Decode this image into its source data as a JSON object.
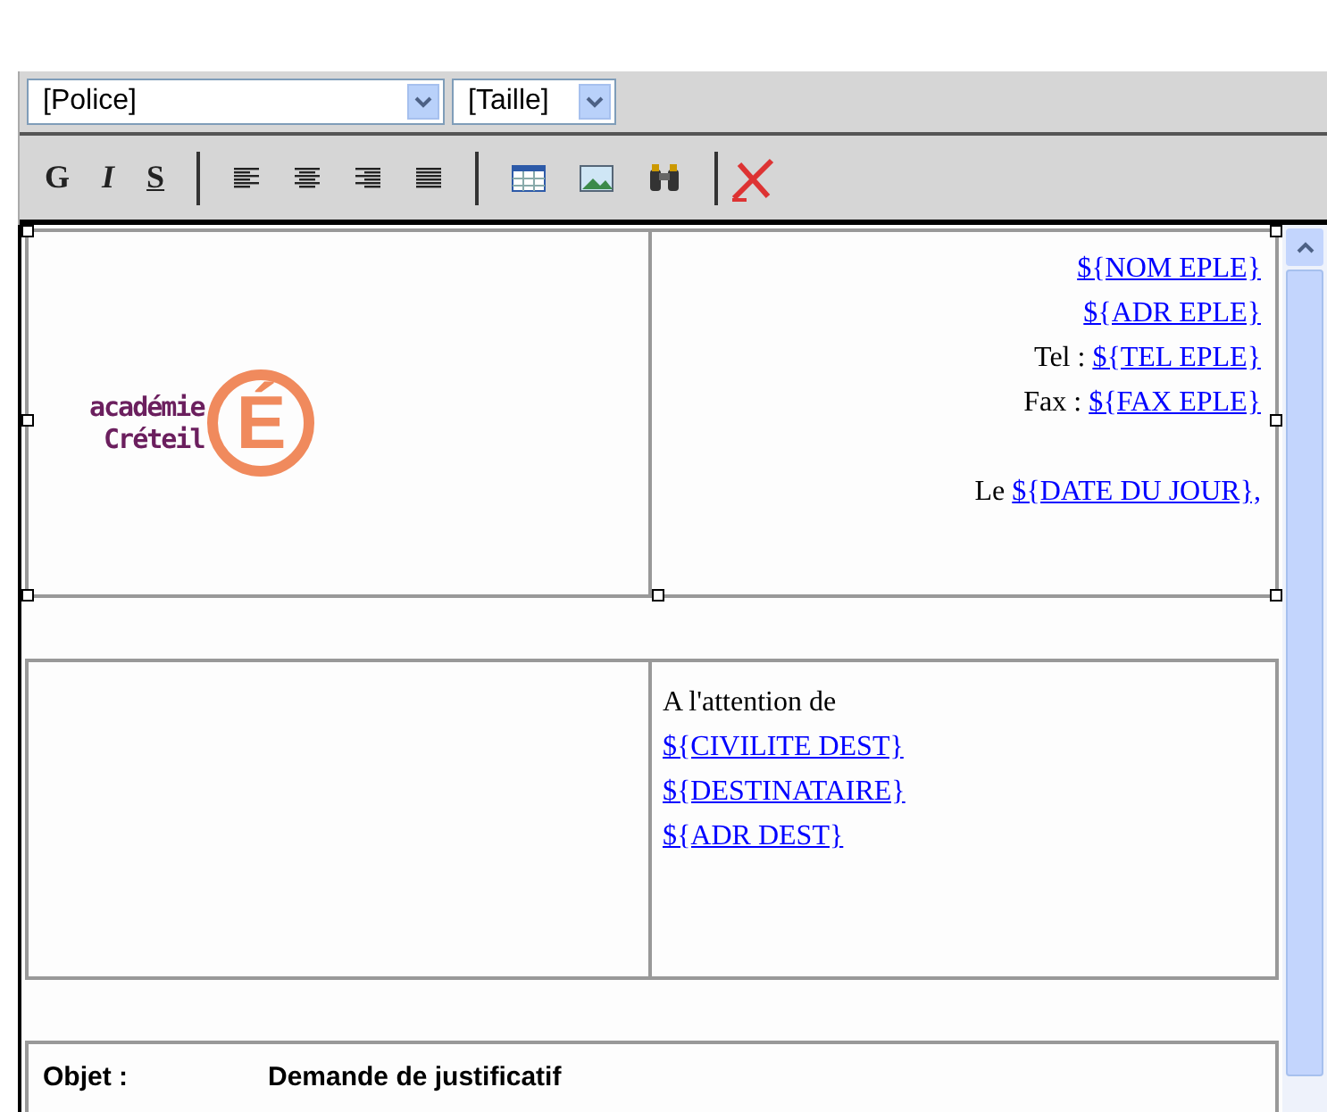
{
  "toolbar": {
    "font_select": {
      "value": "[Police]"
    },
    "size_select": {
      "value": "[Taille]"
    },
    "format_buttons": [
      {
        "label": "G",
        "kind": "bold"
      },
      {
        "label": "I",
        "kind": "italic"
      },
      {
        "label": "S",
        "kind": "underline"
      }
    ],
    "align_buttons": [
      {
        "kind": "left"
      },
      {
        "kind": "center"
      },
      {
        "kind": "right"
      },
      {
        "kind": "justify"
      }
    ],
    "insert_buttons": [
      {
        "kind": "table"
      },
      {
        "kind": "image"
      },
      {
        "kind": "binoculars"
      },
      {
        "kind": "erase"
      }
    ]
  },
  "header": {
    "logo": {
      "lines": [
        "académie",
        "Créteil"
      ],
      "letter": "É"
    },
    "lines": [
      {
        "field": "${NOM EPLE}"
      },
      {
        "field": "${ADR EPLE}"
      },
      {
        "label": "Tel :",
        "field": "${TEL EPLE}"
      },
      {
        "label": "Fax :",
        "field": "${FAX EPLE}"
      }
    ],
    "date": {
      "label": "Le",
      "field": "${DATE DU JOUR},"
    }
  },
  "recipient": {
    "intro": "A l'attention de",
    "fields": [
      "${CIVILITE DEST}",
      "${DESTINATAIRE}",
      "${ADR DEST}"
    ]
  },
  "subject": {
    "label": "Objet :",
    "value": "Demande de justificatif"
  }
}
